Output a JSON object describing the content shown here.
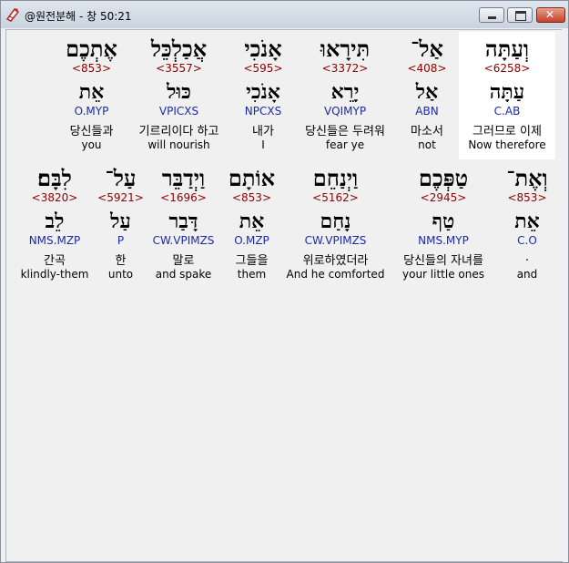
{
  "window": {
    "title": "@원전분해 - 창 50:21"
  },
  "rows": [
    [
      {
        "heb": "וְעַתָּה",
        "strong": "<6258>",
        "root": "עַתָּה",
        "morph": "C.AB",
        "kor": "그러므로 이제",
        "eng": "Now therefore"
      },
      {
        "heb": "אַל־",
        "strong": "<408>",
        "root": "אַל",
        "morph": "ABN",
        "kor": "마소서",
        "eng": "not"
      },
      {
        "heb": "תִּירָאוּ",
        "strong": "<3372>",
        "root": "יָרֵא",
        "morph": "VQIMYP",
        "kor": "당신들은 두려워",
        "eng": "fear ye"
      },
      {
        "heb": "אָנֹכִי",
        "strong": "<595>",
        "root": "אָנֹכִי",
        "morph": "NPCXS",
        "kor": "내가",
        "eng": "I"
      },
      {
        "heb": "אֲכַלְכֵּל",
        "strong": "<3557>",
        "root": "כּוּל",
        "morph": "VPICXS",
        "kor": "기르리이다 하고",
        "eng": "will nourish"
      },
      {
        "heb": "אֶתְכֶם",
        "strong": "<853>",
        "root": "אֵת",
        "morph": "O.MYP",
        "kor": "당신들과",
        "eng": "you"
      }
    ],
    [
      {
        "heb": "וְאֶת־",
        "strong": "<853>",
        "root": "אֵת",
        "morph": "C.O",
        "kor": ".",
        "eng": "and"
      },
      {
        "heb": "טַפְּכֶם",
        "strong": "<2945>",
        "root": "טַף",
        "morph": "NMS.MYP",
        "kor": "당신들의 자녀를",
        "eng": "your little ones"
      },
      {
        "heb": "וַיְנַחֵם",
        "strong": "<5162>",
        "root": "נָחַם",
        "morph": "CW.VPIMZS",
        "kor": "위로하였더라",
        "eng": "And he comforted"
      },
      {
        "heb": "אוֹתָם",
        "strong": "<853>",
        "root": "אֵת",
        "morph": "O.MZP",
        "kor": "그들을",
        "eng": "them"
      },
      {
        "heb": "וַיְדַבֵּר",
        "strong": "<1696>",
        "root": "דָּבַר",
        "morph": "CW.VPIMZS",
        "kor": "말로",
        "eng": "and spake"
      },
      {
        "heb": "עַל־",
        "strong": "<5921>",
        "root": "עַל",
        "morph": "P",
        "kor": "한",
        "eng": "unto"
      },
      {
        "heb": "לִבָּם׃",
        "strong": "<3820>",
        "root": "לֵב",
        "morph": "NMS.MZP",
        "kor": "간곡",
        "eng": "klindly-them"
      }
    ]
  ]
}
